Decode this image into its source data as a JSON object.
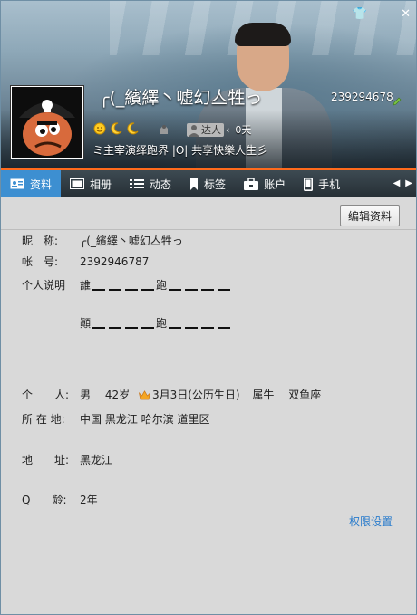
{
  "header": {
    "nickname": "╭(_繽繹丶嘘幻亼牲っ",
    "account_number": "2392946787",
    "signature": "ミ主宰演绎跑界 |O| 共享快樂人生彡",
    "daren_label": "达人",
    "daren_days": "0天",
    "title_buttons": [
      "👕",
      "—",
      "✕"
    ]
  },
  "tabs": [
    {
      "label": "资料",
      "icon": "profile-card-icon",
      "active": true
    },
    {
      "label": "相册",
      "icon": "photo-album-icon",
      "active": false
    },
    {
      "label": "动态",
      "icon": "feed-list-icon",
      "active": false
    },
    {
      "label": "标签",
      "icon": "bookmark-icon",
      "active": false
    },
    {
      "label": "账户",
      "icon": "wallet-icon",
      "active": false
    },
    {
      "label": "手机",
      "icon": "phone-icon",
      "active": false
    }
  ],
  "toolbar": {
    "edit_label": "编辑资料"
  },
  "profile": {
    "nickname_label": "昵　称:",
    "nickname_value": "╭(_繽繹丶嘘幻亼牲っ",
    "account_label": "帐　号:",
    "account_value": "2392946787",
    "desc_label": "个人说明",
    "desc_line1_a": "誰",
    "desc_line1_b": "跑",
    "desc_line2_a": "顚",
    "desc_line2_b": "跑",
    "personal_label": "个　　人:",
    "gender": "男",
    "age": "42岁",
    "birthday": "3月3日(公历生日)",
    "zodiac": "属牛",
    "constellation": "双鱼座",
    "location_label": "所 在 地:",
    "location_value": "中国 黑龙江 哈尔滨 道里区",
    "address_label": "地　　址:",
    "address_value": "黑龙江",
    "qage_label": "Q　　龄:",
    "qage_value": "2年"
  },
  "permission_link": "权限设置",
  "colors": {
    "accent": "#3d8fd1",
    "orange_bar": "#ff6a1c",
    "link": "#2a7ccc"
  }
}
